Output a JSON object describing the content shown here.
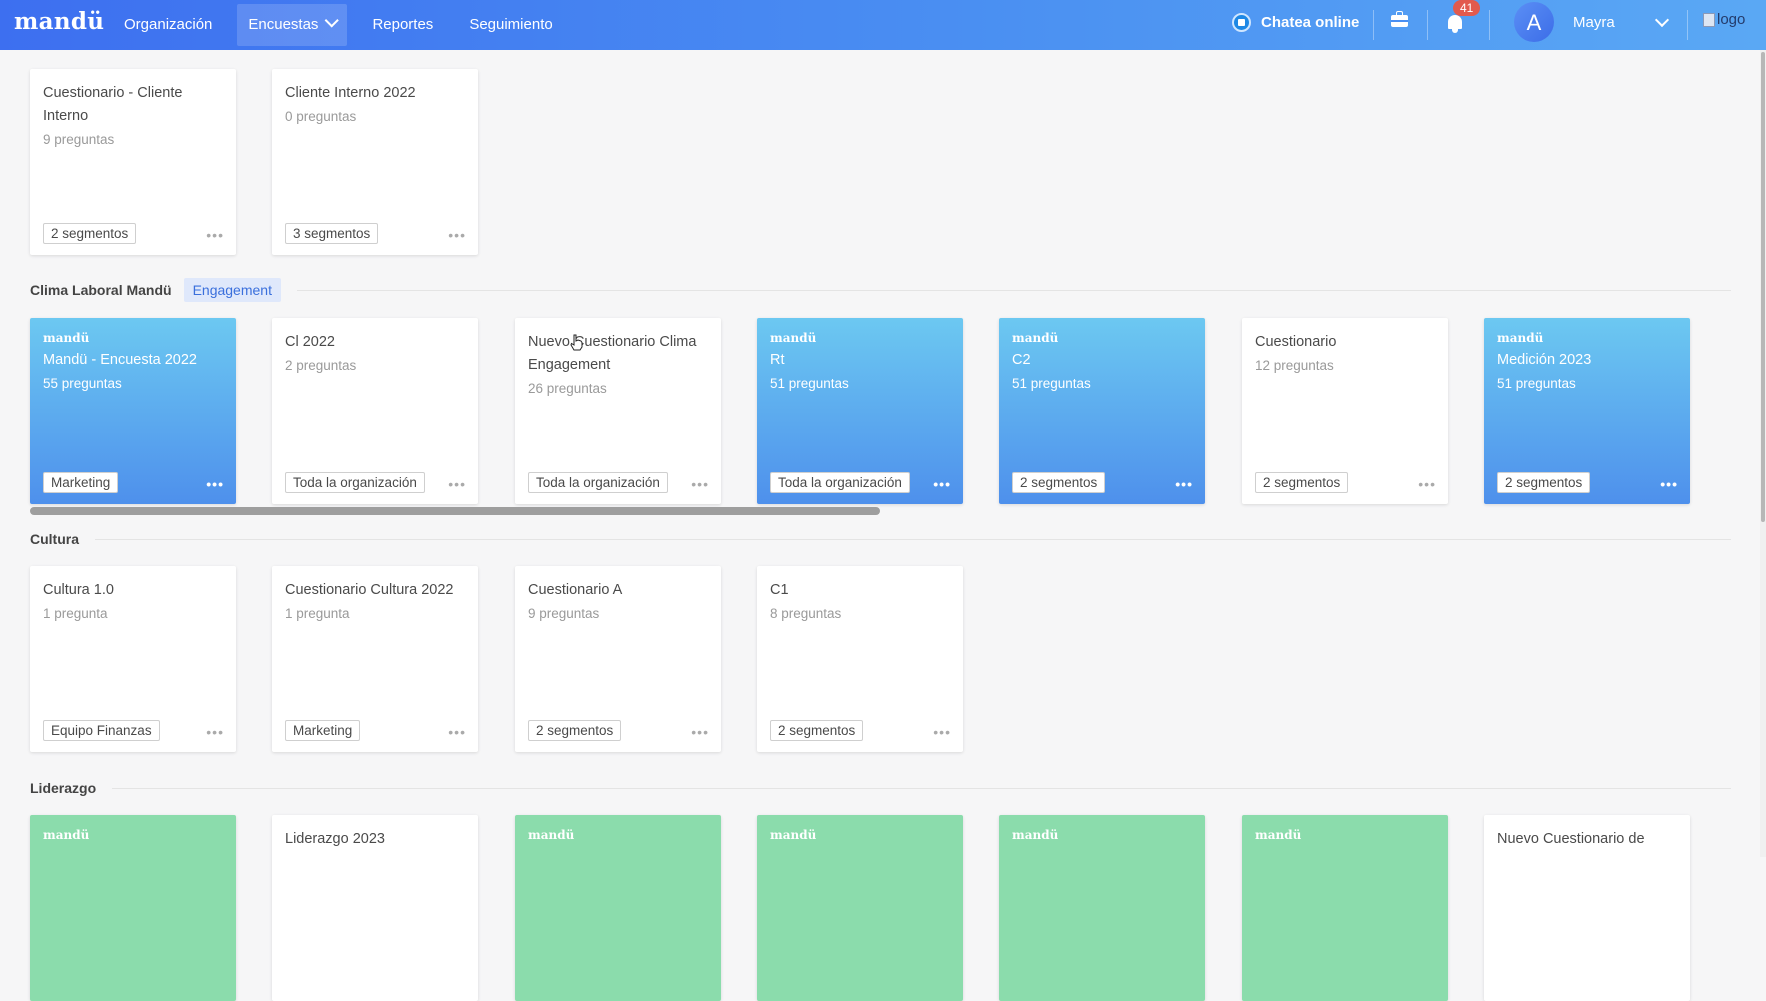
{
  "topbar": {
    "brand": "mandü",
    "nav": [
      {
        "label": "Organización"
      },
      {
        "label": "Encuestas",
        "active": true,
        "dropdown": true
      },
      {
        "label": "Reportes"
      },
      {
        "label": "Seguimiento"
      }
    ],
    "chat_label": "Chatea online",
    "notification_count": "41",
    "avatar_letter": "A",
    "user_name": "Mayra",
    "logo_alt": "logo"
  },
  "sections": {
    "top": {
      "cards": [
        {
          "title": "Cuestionario - Cliente Interno",
          "sub": "9 preguntas",
          "chip": "2 segmentos",
          "style": "white"
        },
        {
          "title": "Cliente Interno 2022",
          "sub": "0 preguntas",
          "chip": "3 segmentos",
          "style": "white"
        }
      ]
    },
    "clima": {
      "title": "Clima Laboral Mandü",
      "tag": "Engagement",
      "cards": [
        {
          "logo": "mandü",
          "title": "Mandü - Encuesta 2022",
          "sub": "55 preguntas",
          "chip": "Marketing",
          "style": "blue"
        },
        {
          "title": "Cl 2022",
          "sub": "2 preguntas",
          "chip": "Toda la organización",
          "style": "white"
        },
        {
          "title": "Nuevo Cuestionario Clima Engagement",
          "sub": "26 preguntas",
          "chip": "Toda la organización",
          "style": "white"
        },
        {
          "logo": "mandü",
          "title": "Rt",
          "sub": "51 preguntas",
          "chip": "Toda la organización",
          "style": "blue"
        },
        {
          "logo": "mandü",
          "title": "C2",
          "sub": "51 preguntas",
          "chip": "2 segmentos",
          "style": "blue"
        },
        {
          "title": "Cuestionario",
          "sub": "12 preguntas",
          "chip": "2 segmentos",
          "style": "white"
        },
        {
          "logo": "mandü",
          "title": "Medición 2023",
          "sub": "51 preguntas",
          "chip": "2 segmentos",
          "style": "blue"
        }
      ]
    },
    "cultura": {
      "title": "Cultura",
      "cards": [
        {
          "title": "Cultura 1.0",
          "sub": "1 pregunta",
          "chip": "Equipo Finanzas",
          "style": "white"
        },
        {
          "title": "Cuestionario Cultura 2022",
          "sub": "1 pregunta",
          "chip": "Marketing",
          "style": "white"
        },
        {
          "title": "Cuestionario A",
          "sub": "9 preguntas",
          "chip": "2 segmentos",
          "style": "white"
        },
        {
          "title": "C1",
          "sub": "8 preguntas",
          "chip": "2 segmentos",
          "style": "white"
        }
      ]
    },
    "liderazgo": {
      "title": "Liderazgo",
      "cards": [
        {
          "logo": "mandü",
          "style": "green"
        },
        {
          "title": "Liderazgo 2023",
          "style": "white"
        },
        {
          "logo": "mandü",
          "style": "green"
        },
        {
          "logo": "mandü",
          "style": "green"
        },
        {
          "logo": "mandü",
          "style": "green"
        },
        {
          "logo": "mandü",
          "style": "green"
        },
        {
          "title": "Nuevo Cuestionario de",
          "style": "white"
        }
      ]
    }
  },
  "colors": {
    "topbar_start": "#3d6ff0",
    "topbar_end": "#5aa8f4",
    "card_blue_top": "#6cc8f1",
    "card_blue_bottom": "#4e90ec",
    "card_green": "#8bdcac",
    "tag_bg": "#dfe8fb",
    "tag_text": "#3a6fdc",
    "badge": "#e25a4e"
  }
}
